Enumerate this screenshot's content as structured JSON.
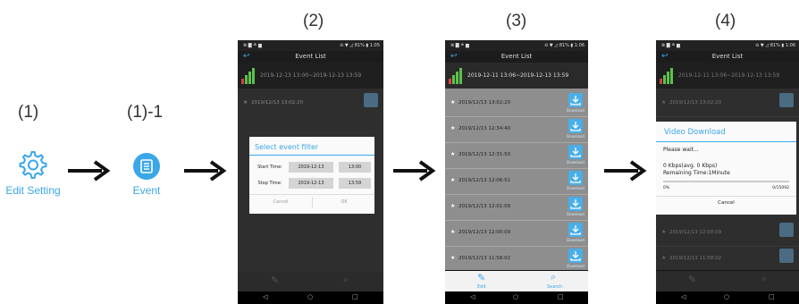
{
  "step_labels": {
    "s1": "(1)",
    "s1_1": "(1)-1",
    "s2": "(2)",
    "s3": "(3)",
    "s4": "(4)"
  },
  "icons": {
    "edit_setting": "Edit Setting",
    "event": "Event"
  },
  "status_bar": {
    "left": "⊗ ▇ ≛ ▆",
    "right": "⊖ ▼ ◿ 81% ▮ 1:05",
    "right3": "⊖ ▼ ◿ 81% ▮ 1:06"
  },
  "app_title": "Event List",
  "range": "2019-12-13 13:00~2019-12-13 13:59",
  "range3": "2019-12-11 13:06~2019-12-13 13:59",
  "range4": "2019-12-11 13:06~2019-12-13 13:59",
  "events": [
    "2019/12/13  13:02:20",
    "2019/12/13  12:34:40",
    "2019/12/13  12:31:50",
    "2019/12/13  12:06:51",
    "2019/12/13  12:01:09",
    "2019/12/13  12:00:09",
    "2019/12/13  11:58:02"
  ],
  "download_label": "Download",
  "filter_dialog": {
    "title": "Select event filter",
    "start_label": "Start Time:",
    "start_date": "2019-12-13",
    "start_time": "13:00",
    "stop_label": "Stop Time:",
    "stop_date": "2019-12-13",
    "stop_time": "13:59",
    "cancel": "Cancel",
    "ok": "OK"
  },
  "download_dialog": {
    "title": "Video Download",
    "wait": "Please wait...",
    "speed": "0 Kbps(avg. 0 Kbps)",
    "remaining": "Remaining Time:1Minute",
    "percent": "0%",
    "count": "0/15092",
    "progress": 0,
    "cancel": "Cancel"
  },
  "bottom_bar": {
    "edit": "Edit",
    "search": "Search"
  },
  "nav": {
    "back": "◁",
    "home": "○",
    "recent": "□"
  },
  "colors": {
    "accent": "#3aa7e8",
    "list_bg": "#8e8e8e",
    "dark": "#111111"
  }
}
